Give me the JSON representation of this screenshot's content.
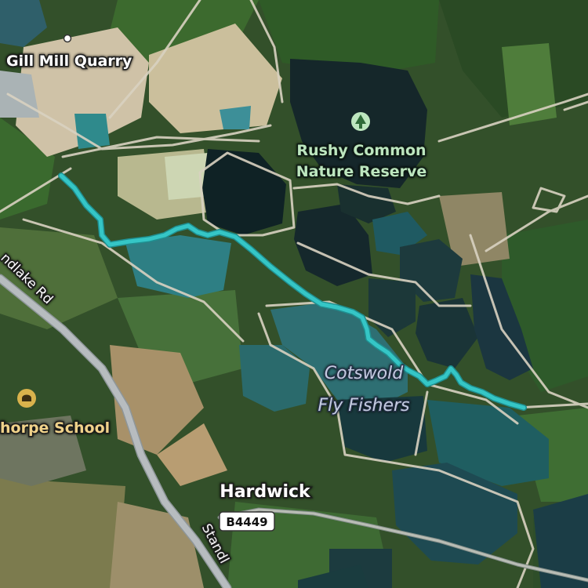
{
  "map": {
    "labels": {
      "quarry": "Gill Mill Quarry",
      "reserve_line1": "Rushy Common",
      "reserve_line2": "Nature Reserve",
      "fishers_line1": "Cotswold",
      "fishers_line2": "Fly Fishers",
      "school": "horpe School",
      "village": "Hardwick",
      "road_sign": "B4449",
      "road_standlake_nw": "ndlake Rd",
      "road_standlake_s": "Standl"
    },
    "icons": {
      "reserve": "tree-icon",
      "school": "school-icon",
      "quarry": "place-dot-icon"
    },
    "colors": {
      "route": "#35c6c6",
      "poi_green": "#bde6bf",
      "school_icon": "#d9b24c",
      "road_main": "#b7bcbf",
      "track": "#d9d2c1"
    }
  }
}
